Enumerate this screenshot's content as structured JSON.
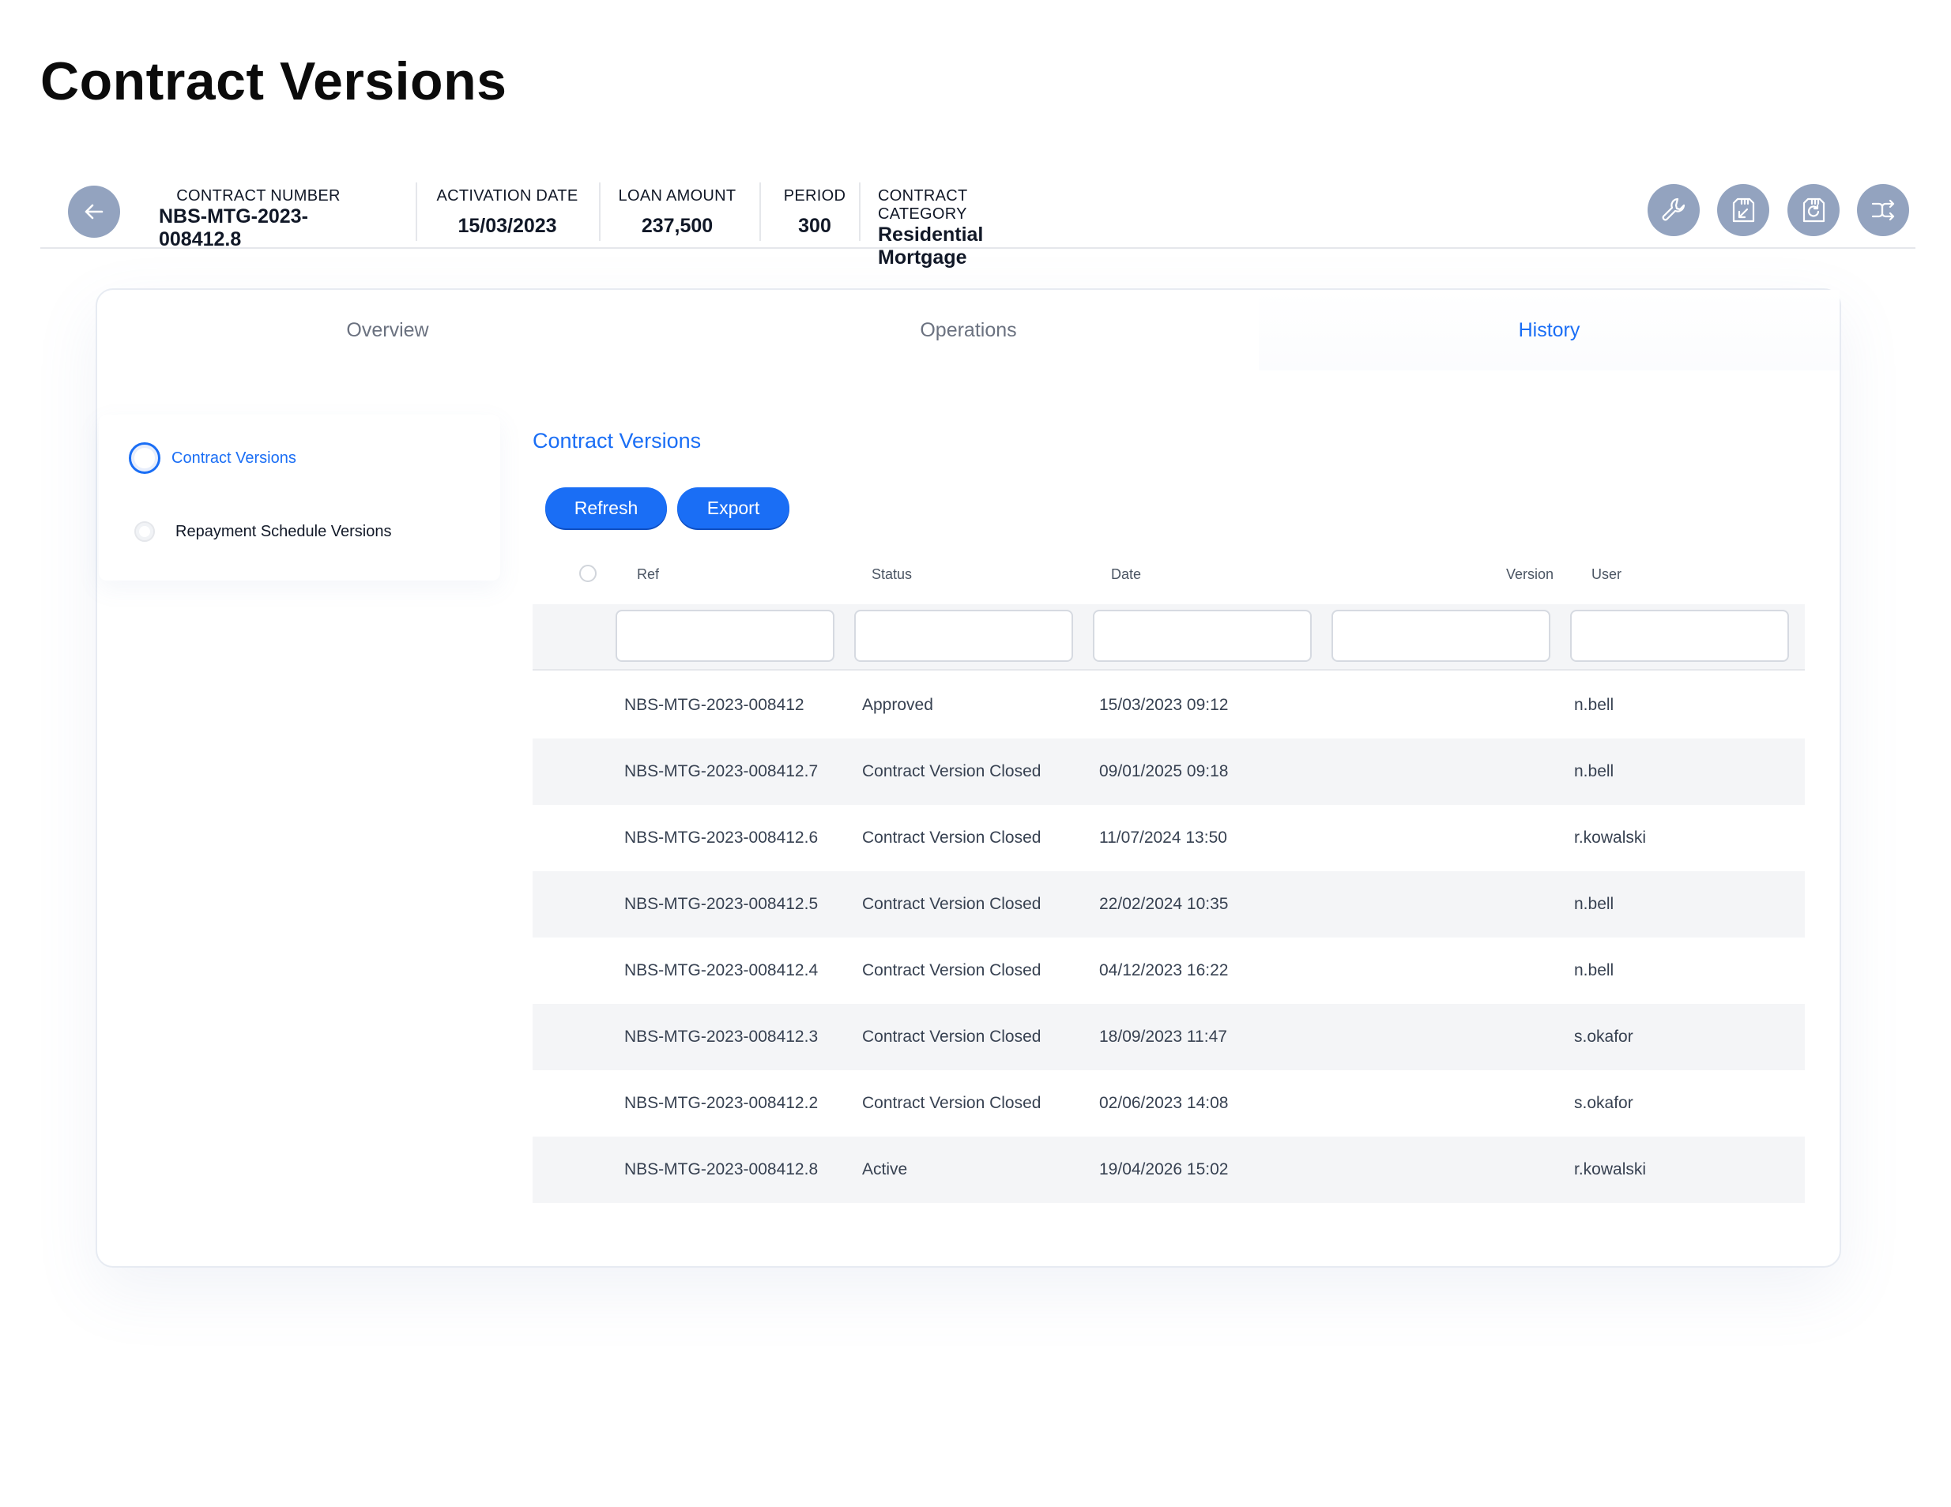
{
  "page": {
    "title": "Contract Versions"
  },
  "header": {
    "fields": [
      {
        "label": "CONTRACT NUMBER",
        "value": "NBS-MTG-2023-008412.8"
      },
      {
        "label": "ACTIVATION DATE",
        "value": "15/03/2023"
      },
      {
        "label": "LOAN AMOUNT",
        "value": "237,500"
      },
      {
        "label": "PERIOD",
        "value": "300"
      },
      {
        "label": "CONTRACT CATEGORY",
        "value": "Residential Mortgage"
      }
    ],
    "icons": [
      "back-arrow-icon",
      "wrench-icon",
      "import-icon",
      "sync-icon",
      "merge-icon"
    ]
  },
  "tabs": [
    {
      "label": "Overview",
      "active": false
    },
    {
      "label": "Operations",
      "active": false
    },
    {
      "label": "History",
      "active": true
    }
  ],
  "sidebar": {
    "items": [
      {
        "label": "Contract Versions",
        "selected": true
      },
      {
        "label": "Repayment Schedule Versions",
        "selected": false
      }
    ]
  },
  "content": {
    "title": "Contract Versions",
    "buttons": {
      "refresh": "Refresh",
      "export": "Export"
    },
    "columns": [
      "Ref",
      "Status",
      "Date",
      "Version",
      "User"
    ],
    "rows": [
      {
        "ref": "NBS-MTG-2023-008412",
        "status": "Approved",
        "date": "15/03/2023 09:12",
        "version": "",
        "user": "n.bell"
      },
      {
        "ref": "NBS-MTG-2023-008412.7",
        "status": "Contract Version Closed",
        "date": "09/01/2025 09:18",
        "version": "",
        "user": "n.bell"
      },
      {
        "ref": "NBS-MTG-2023-008412.6",
        "status": "Contract Version Closed",
        "date": "11/07/2024 13:50",
        "version": "",
        "user": "r.kowalski"
      },
      {
        "ref": "NBS-MTG-2023-008412.5",
        "status": "Contract Version Closed",
        "date": "22/02/2024 10:35",
        "version": "",
        "user": "n.bell"
      },
      {
        "ref": "NBS-MTG-2023-008412.4",
        "status": "Contract Version Closed",
        "date": "04/12/2023 16:22",
        "version": "",
        "user": "n.bell"
      },
      {
        "ref": "NBS-MTG-2023-008412.3",
        "status": "Contract Version Closed",
        "date": "18/09/2023 11:47",
        "version": "",
        "user": "s.okafor"
      },
      {
        "ref": "NBS-MTG-2023-008412.2",
        "status": "Contract Version Closed",
        "date": "02/06/2023 14:08",
        "version": "",
        "user": "s.okafor"
      },
      {
        "ref": "NBS-MTG-2023-008412.8",
        "status": "Active",
        "date": "19/04/2026 15:02",
        "version": "",
        "user": "r.kowalski"
      }
    ]
  },
  "colors": {
    "accent": "#1a6ef5",
    "icon_button": "#93a3bf",
    "row_alt": "#f4f5f7"
  }
}
